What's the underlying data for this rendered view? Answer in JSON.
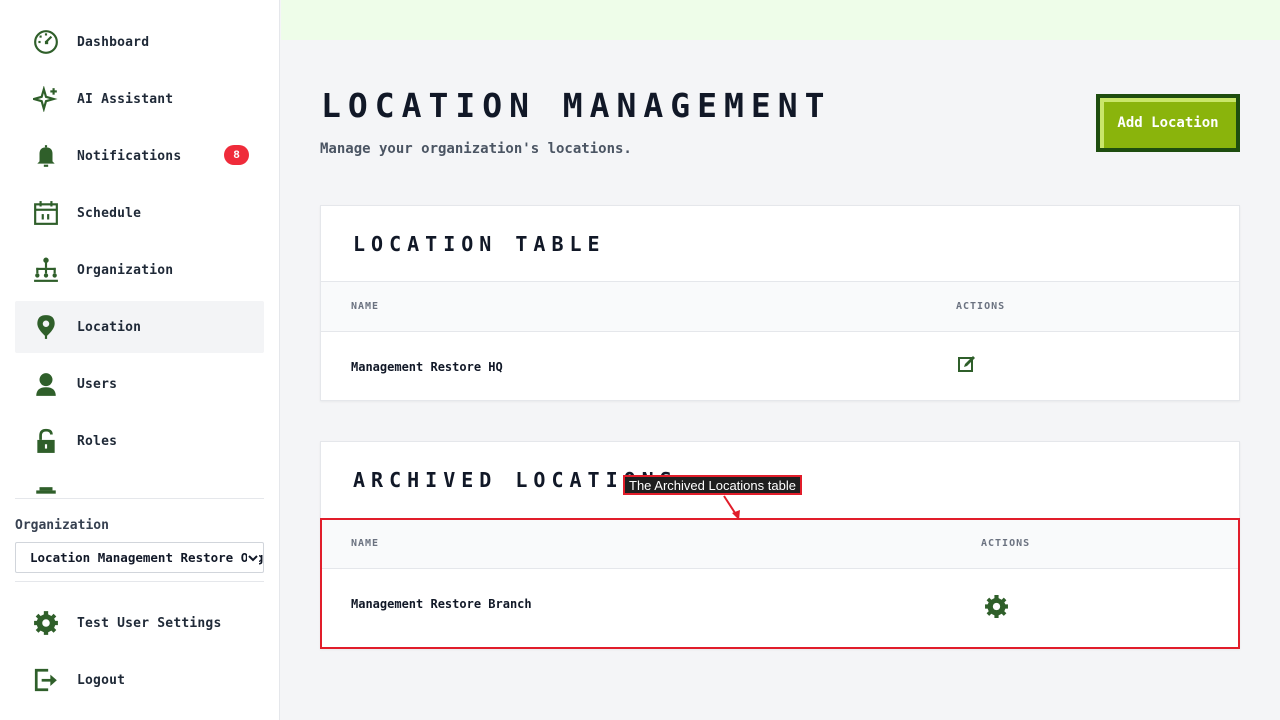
{
  "sidebar": {
    "items": [
      {
        "label": "Dashboard",
        "icon": "dashboard-icon"
      },
      {
        "label": "AI Assistant",
        "icon": "sparkle-icon"
      },
      {
        "label": "Notifications",
        "icon": "bell-icon",
        "badge": "8"
      },
      {
        "label": "Schedule",
        "icon": "calendar-icon"
      },
      {
        "label": "Organization",
        "icon": "org-chart-icon"
      },
      {
        "label": "Location",
        "icon": "location-pin-icon",
        "active": true
      },
      {
        "label": "Users",
        "icon": "user-icon"
      },
      {
        "label": "Roles",
        "icon": "unlock-icon"
      }
    ],
    "organization": {
      "label": "Organization",
      "selected": "Location Management Restore Org"
    },
    "bottom_items": [
      {
        "label": "Test User Settings",
        "icon": "gear-icon"
      },
      {
        "label": "Logout",
        "icon": "logout-icon"
      }
    ]
  },
  "header": {
    "title": "LOCATION MANAGEMENT",
    "subtitle": "Manage your organization's locations.",
    "add_button": "Add Location"
  },
  "location_table": {
    "title": "LOCATION TABLE",
    "columns": [
      "NAME",
      "ACTIONS"
    ],
    "rows": [
      {
        "name": "Management Restore HQ",
        "action_icon": "edit-icon"
      }
    ]
  },
  "archived_table": {
    "title": "ARCHIVED LOCATIONS",
    "columns": [
      "NAME",
      "ACTIONS"
    ],
    "rows": [
      {
        "name": "Management Restore Branch",
        "action_icon": "gear-icon"
      }
    ]
  },
  "annotation": {
    "label": "The Archived Locations table",
    "color": "#e11d2a"
  },
  "colors": {
    "icon_green": "#2f5f2a",
    "accent": "#8ab40c",
    "accent_border": "#1e4d0f",
    "badge": "#ef2b3a",
    "topbar": "#eefde9"
  }
}
